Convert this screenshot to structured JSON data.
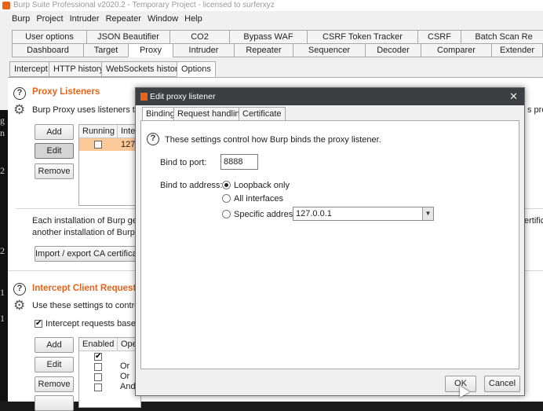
{
  "window": {
    "title": "Burp Suite Professional v2020.2 - Temporary Project - licensed to surferxyz"
  },
  "menu": [
    "Burp",
    "Project",
    "Intruder",
    "Repeater",
    "Window",
    "Help"
  ],
  "tabs_row1": [
    "User options",
    "JSON Beautifier",
    "CO2",
    "Bypass WAF",
    "CSRF Token Tracker",
    "CSRF",
    "Batch Scan Re"
  ],
  "tabs_row2": [
    "Dashboard",
    "Target",
    "Proxy",
    "Intruder",
    "Repeater",
    "Sequencer",
    "Decoder",
    "Comparer",
    "Extender"
  ],
  "active_main_tab": "Proxy",
  "proxy_tabs": [
    "Intercept",
    "HTTP history",
    "WebSockets history",
    "Options"
  ],
  "active_proxy_tab": "Options",
  "left_strip": [
    "g",
    "n",
    "2",
    "2",
    "1",
    "1"
  ],
  "listeners": {
    "title": "Proxy Listeners",
    "desc": "Burp Proxy uses listeners to re",
    "desc_right": "s prox",
    "buttons": {
      "add": "Add",
      "edit": "Edit",
      "remove": "Remove"
    },
    "columns": [
      "Running",
      "Inter"
    ],
    "rows": [
      {
        "running": false,
        "interface": "127."
      }
    ],
    "ca_text_line1": "Each installation of Burp genera",
    "ca_text_line2": "another installation of Burp.",
    "ca_right": "ertific",
    "ca_button": "Import / export CA certificate"
  },
  "intercept_client": {
    "title": "Intercept Client Requests",
    "desc": "Use these settings to control w",
    "checkbox_label": "Intercept requests based or",
    "checkbox_checked": true,
    "buttons": {
      "add": "Add",
      "edit": "Edit",
      "remove": "Remove"
    },
    "columns": [
      "Enabled",
      "Ope"
    ],
    "rows": [
      {
        "enabled": true,
        "op": ""
      },
      {
        "enabled": false,
        "op": "Or"
      },
      {
        "enabled": false,
        "op": "Or"
      },
      {
        "enabled": false,
        "op": "And"
      }
    ]
  },
  "dialog": {
    "title": "Edit proxy listener",
    "tabs": [
      "Binding",
      "Request handling",
      "Certificate"
    ],
    "active_tab": "Binding",
    "info": "These settings control how Burp binds the proxy listener.",
    "port_label": "Bind to port:",
    "port_value": "8888",
    "address_label": "Bind to address:",
    "options": [
      "Loopback only",
      "All interfaces",
      "Specific address:"
    ],
    "selected_option": "Loopback only",
    "specific_address": "127.0.0.1",
    "ok": "OK",
    "cancel": "Cancel"
  },
  "colors": {
    "accent": "#e8631a",
    "selected_row": "#fcc998",
    "dialog_title": "#3c3f41"
  }
}
